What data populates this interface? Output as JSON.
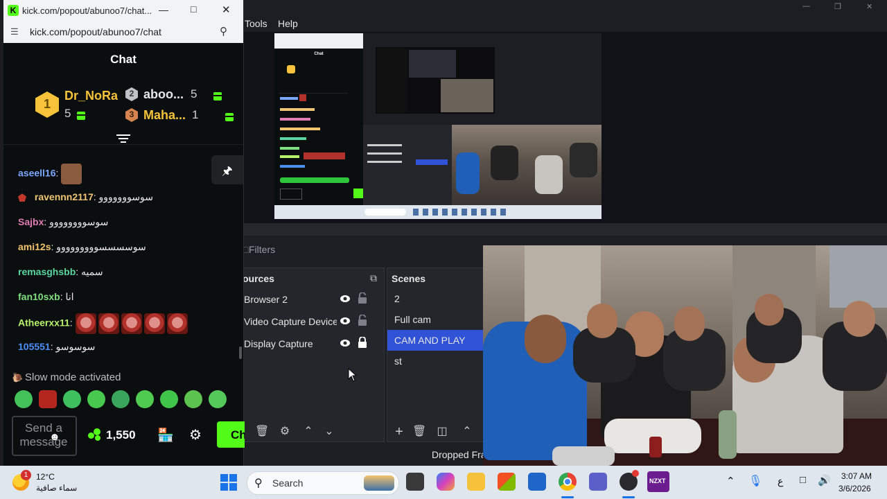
{
  "chat_window": {
    "title": "kick.com/popout/abunoo7/chat...",
    "url": "kick.com/popout/abunoo7/chat",
    "header": "Chat",
    "leaderboard": [
      {
        "rank": "1",
        "name": "Dr_NoRa",
        "count": "5"
      },
      {
        "rank": "2",
        "name": "aboo...",
        "count": "5"
      },
      {
        "rank": "3",
        "name": "Maha...",
        "count": "1"
      }
    ],
    "messages": [
      {
        "user": "aseell16",
        "sep": ":",
        "text": "",
        "color": "#7aa7ff"
      },
      {
        "user": "ravennn2117",
        "sep": ":",
        "text": "سوسووووووو",
        "color": "#f0c674"
      },
      {
        "user": "Sajbx",
        "sep": ":",
        "text": "سوسوووووووو",
        "color": "#e07bb5"
      },
      {
        "user": "ami12s",
        "sep": ":",
        "text": "سوسسسسووووووووو",
        "color": "#f4c56a"
      },
      {
        "user": "remasghsbb",
        "sep": ":",
        "text": "سميه",
        "color": "#5bd6a3"
      },
      {
        "user": "fan10sxb",
        "sep": ":",
        "text": "انا",
        "color": "#7ee07e"
      },
      {
        "user": "Atheerxx11",
        "sep": ":",
        "text": "",
        "color": "#b6f36b"
      },
      {
        "user": "105551",
        "sep": ":",
        "text": "سوسوسو",
        "color": "#4a8ff7"
      }
    ],
    "slow_mode": "Slow mode activated",
    "input_placeholder": "Send a message",
    "points": "1,550",
    "chat_button": "Ch"
  },
  "obs": {
    "menu": [
      "Tools",
      "Help"
    ],
    "filters_tab": "Filters",
    "sources_title": "ources",
    "sources": [
      {
        "name": "Browser 2",
        "locked": false
      },
      {
        "name": "Video Capture Device 2",
        "locked": false
      },
      {
        "name": "Display Capture",
        "locked": true
      }
    ],
    "scenes_title": "Scenes",
    "scenes": [
      {
        "name": "2",
        "selected": false
      },
      {
        "name": "Full cam",
        "selected": false
      },
      {
        "name": "CAM AND PLAY",
        "selected": true
      },
      {
        "name": "st",
        "selected": false
      }
    ],
    "status": "Dropped Fra"
  },
  "taskbar": {
    "weather_temp": "12°C",
    "weather_desc": "سماء صافية",
    "weather_badge": "1",
    "search_label": "Search",
    "time": "3:07 AM",
    "date": "3/6/2026",
    "lang": "ع",
    "nzxt_label": "NZXT"
  },
  "colors": {
    "kick_green": "#53fc18",
    "obs_selected": "#2f52d6",
    "gold": "#f6c33b"
  }
}
